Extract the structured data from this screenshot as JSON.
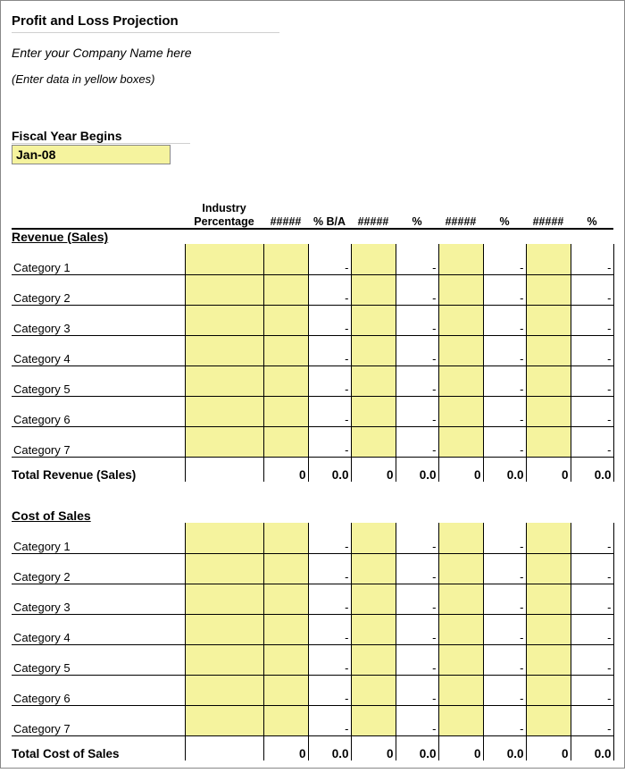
{
  "title": "Profit and Loss Projection",
  "company_placeholder": "Enter your Company Name here",
  "instruction": "(Enter data in yellow boxes)",
  "fiscal_year": {
    "label": "Fiscal Year Begins",
    "value": "Jan-08"
  },
  "headers": {
    "industry": "Industry Percentage",
    "hash": "#####",
    "pct_ba": "% B/A",
    "pct": "%"
  },
  "sections": [
    {
      "name": "Revenue (Sales)",
      "rows": [
        "Category 1",
        "Category 2",
        "Category 3",
        "Category 4",
        "Category 5",
        "Category 6",
        "Category 7"
      ],
      "total_label": "Total Revenue (Sales)",
      "total_n": "0",
      "total_p": "0.0"
    },
    {
      "name": "Cost of Sales",
      "rows": [
        "Category 1",
        "Category 2",
        "Category 3",
        "Category 4",
        "Category 5",
        "Category 6",
        "Category 7"
      ],
      "total_label": "Total Cost of Sales",
      "total_n": "0",
      "total_p": "0.0"
    }
  ],
  "dash": "-"
}
